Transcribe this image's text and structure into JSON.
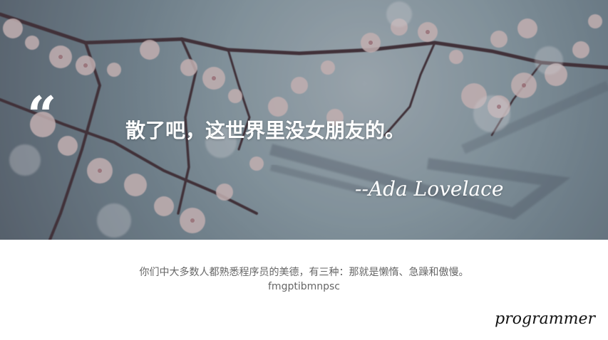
{
  "banner": {
    "quote_mark": "“",
    "quote_text": "散了吧，这世界里没女朋友的。",
    "author": "--Ada Lovelace"
  },
  "caption": {
    "line1": "你们中大多数人都熟悉程序员的美德，有三种：那就是懒惰、急躁和傲慢。",
    "line2": "fmgptibmnpsc"
  },
  "signature": "programmer",
  "colors": {
    "quote_text": "#ffffff",
    "caption_text": "#666666",
    "signature_text": "#111111"
  }
}
